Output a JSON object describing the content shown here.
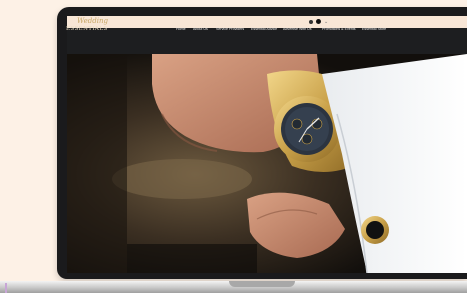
{
  "site": {
    "logo": {
      "script": "Wedding",
      "main": "ESSENTIALS"
    },
    "nav": [
      {
        "label": "Home"
      },
      {
        "label": "About Us"
      },
      {
        "label": "Service Providers"
      },
      {
        "label": "Essential Advice"
      },
      {
        "label": "Advertise With Us"
      },
      {
        "label": "Promotions & Events"
      },
      {
        "label": "Essential Store"
      }
    ]
  },
  "hero": {
    "image": "groom-adjusting-gold-watch-and-cufflink"
  },
  "colors": {
    "page_bg": "#fdf1e6",
    "nav_bg": "#1d1e20",
    "gold": "#c8a86a"
  }
}
